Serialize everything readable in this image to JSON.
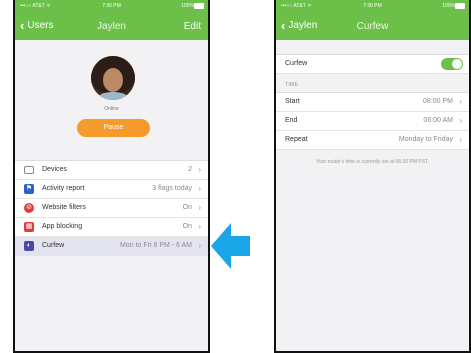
{
  "status": {
    "carrier": "•••○○ AT&T ᯤ",
    "time": "7:30 PM",
    "battery": "100%"
  },
  "left": {
    "nav": {
      "back": "Users",
      "title": "Jaylen",
      "edit": "Edit"
    },
    "profile": {
      "status": "Online",
      "pause_label": "Pause"
    },
    "rows": [
      {
        "label": "Devices",
        "value": "2",
        "icon": "devices-icon"
      },
      {
        "label": "Activity report",
        "value": "3 flags today",
        "icon": "flag-icon"
      },
      {
        "label": "Website filters",
        "value": "On",
        "icon": "block-icon"
      },
      {
        "label": "App blocking",
        "value": "On",
        "icon": "grid-icon"
      },
      {
        "label": "Curfew",
        "value": "Mon to Fri 8 PM - 6 AM",
        "icon": "moon-clock-icon"
      }
    ]
  },
  "right": {
    "nav": {
      "back": "Jaylen",
      "title": "Curfew"
    },
    "curfew_label": "Curfew",
    "curfew_enabled": true,
    "section_header": "TIME",
    "rows": [
      {
        "label": "Start",
        "value": "08:00 PM"
      },
      {
        "label": "End",
        "value": "06:00 AM"
      },
      {
        "label": "Repeat",
        "value": "Monday to Friday"
      }
    ],
    "footnote": "Your router's time is currently set at 06:30 PM PST."
  },
  "colors": {
    "brand_green": "#6cc04a",
    "pause_orange": "#f59b2b",
    "arrow_blue": "#1aa6e6"
  }
}
